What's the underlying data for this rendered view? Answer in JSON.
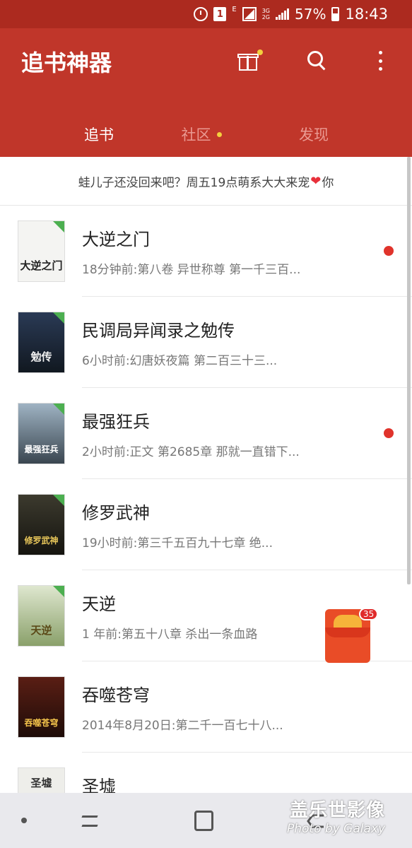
{
  "status_bar": {
    "sim_label": "1",
    "e_label": "E",
    "net_top": "3G",
    "net_bottom": "2G",
    "battery": "57%",
    "time": "18:43"
  },
  "app_bar": {
    "title": "追书神器",
    "accent_color": "#c0362a",
    "icons": [
      "gift-icon",
      "search-icon",
      "more-icon"
    ]
  },
  "tabs": [
    {
      "label": "追书",
      "active": true
    },
    {
      "label": "社区",
      "active": false
    },
    {
      "label": "发现",
      "active": false
    }
  ],
  "notice": {
    "text_before": "蛙儿子还没回来吧？周五19点萌系大大来宠",
    "heart": "❤",
    "text_after": "你"
  },
  "books": [
    {
      "title": "大逆之门",
      "subtitle": "18分钟前:第八卷 异世称尊 第一千三百...",
      "cover_text": "大逆之门",
      "unread": true
    },
    {
      "title": "民调局异闻录之勉传",
      "subtitle": "6小时前:幻唐妖夜篇 第二百三十三...",
      "cover_text": "勉传",
      "unread": false
    },
    {
      "title": "最强狂兵",
      "subtitle": "2小时前:正文 第2685章 那就一直错下...",
      "cover_text": "最强狂兵",
      "unread": true
    },
    {
      "title": "修罗武神",
      "subtitle": "19小时前:第三千五百九十七章 绝...",
      "cover_text": "修罗武神",
      "unread": false
    },
    {
      "title": "天逆",
      "subtitle": "1 年前:第五十八章 杀出一条血路",
      "cover_text": "天逆",
      "unread": false
    },
    {
      "title": "吞噬苍穹",
      "subtitle": "2014年8月20日:第二千一百七十八...",
      "cover_text": "吞噬苍穹",
      "unread": false
    },
    {
      "title": "圣墟",
      "subtitle": "",
      "cover_text": "圣墟",
      "unread": true
    }
  ],
  "red_packet": {
    "badge": "35"
  },
  "watermark": {
    "line1": "盖乐世影像",
    "line2": "Photo by Galaxy"
  }
}
